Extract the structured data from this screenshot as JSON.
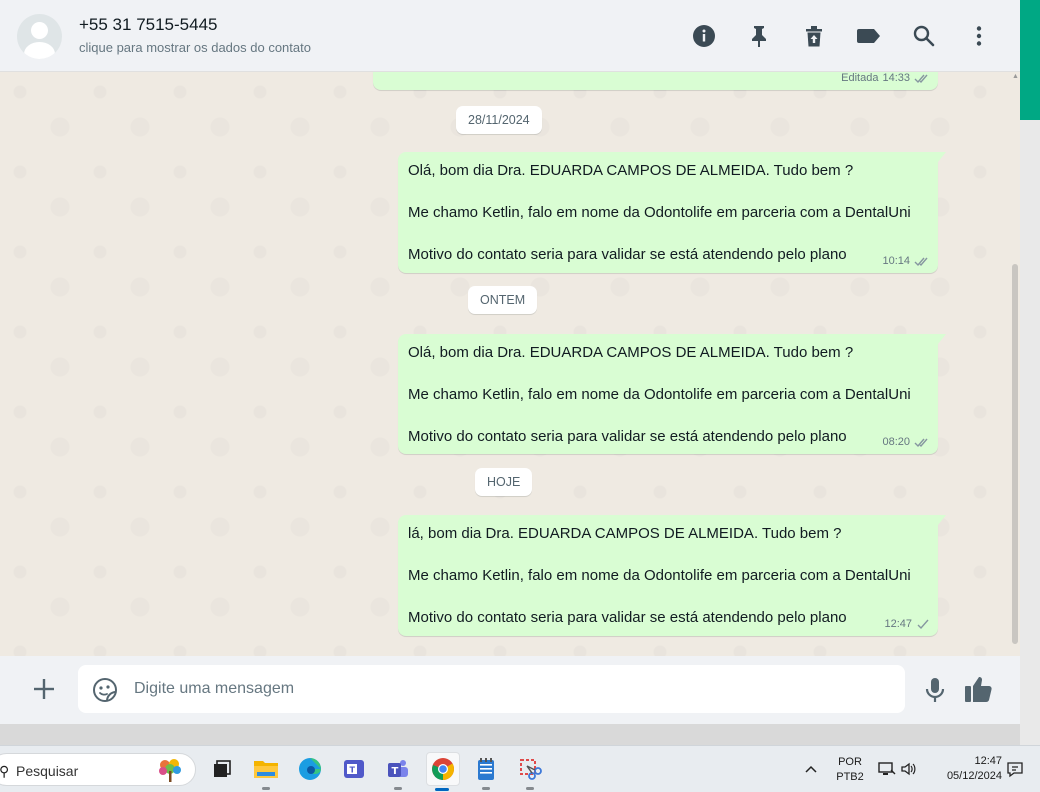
{
  "header": {
    "contact_name": "+55 31 7515-5445",
    "contact_subtitle": "clique para mostrar os dados do contato",
    "icons": [
      "info-icon",
      "pin-icon",
      "delete-icon",
      "label-icon",
      "search-icon",
      "menu-icon"
    ]
  },
  "chat": {
    "top_meta": {
      "edited": "Editada",
      "time": "14:33"
    },
    "date_chips": [
      "28/11/2024",
      "ONTEM",
      "HOJE"
    ],
    "messages": [
      {
        "line1": "Olá, bom dia Dra. EDUARDA CAMPOS DE ALMEIDA. Tudo bem ?",
        "line2": "Me chamo Ketlin, falo em nome da Odontolife em parceria com a DentalUni",
        "line3": "Motivo do contato seria para validar se está atendendo pelo plano",
        "time": "10:14",
        "status": "delivered"
      },
      {
        "line1": "Olá, bom dia Dra. EDUARDA CAMPOS DE ALMEIDA. Tudo bem ?",
        "line2": "Me chamo Ketlin, falo em nome da Odontolife em parceria com a DentalUni",
        "line3": "Motivo do contato seria para validar se está atendendo pelo plano",
        "time": "08:20",
        "status": "delivered"
      },
      {
        "line1": "lá, bom dia Dra. EDUARDA CAMPOS DE ALMEIDA. Tudo bem ?",
        "line2": "Me chamo Ketlin, falo em nome da Odontolife em parceria com a DentalUni",
        "line3": "Motivo do contato seria para validar se está atendendo pelo plano",
        "time": "12:47",
        "status": "sent"
      }
    ]
  },
  "composer": {
    "placeholder": "Digite uma mensagem"
  },
  "taskbar": {
    "search_label": "Pesquisar",
    "apps": [
      "task-view-icon",
      "file-explorer-icon",
      "edge-icon",
      "teams-classic-icon",
      "teams-icon",
      "chrome-icon",
      "notepad-icon",
      "snipping-tool-icon"
    ],
    "active_app": "chrome-icon",
    "language": "POR",
    "keyboard": "PTB2",
    "time": "12:47",
    "date": "05/12/2024"
  },
  "colors": {
    "bubble_out": "#d9fdd3",
    "chat_bg": "#efeae2",
    "header_bg": "#f0f2f5",
    "accent": "#00a884",
    "read_tick": "#8696a0"
  }
}
